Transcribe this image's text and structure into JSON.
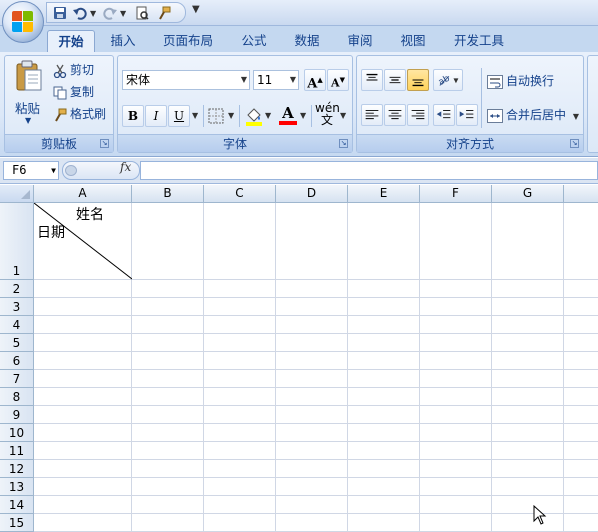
{
  "ribbon": {
    "tabs": [
      {
        "label": "开始",
        "active": true
      },
      {
        "label": "插入"
      },
      {
        "label": "页面布局"
      },
      {
        "label": "公式"
      },
      {
        "label": "数据"
      },
      {
        "label": "审阅"
      },
      {
        "label": "视图"
      },
      {
        "label": "开发工具"
      }
    ],
    "clipboard": {
      "paste": "粘贴",
      "cut": "剪切",
      "copy": "复制",
      "format_painter": "格式刷",
      "group_label": "剪贴板"
    },
    "font": {
      "font_name": "宋体",
      "font_size": "11",
      "grow_font": "A",
      "shrink_font": "A",
      "bold": "B",
      "italic": "I",
      "underline": "U",
      "font_color": "A",
      "phonetic": "wén 文",
      "group_label": "字体"
    },
    "alignment": {
      "wrap_text": "自动换行",
      "merge_center": "合并后居中",
      "group_label": "对齐方式"
    }
  },
  "formula_bar": {
    "name_box": "F6",
    "fx": "fx",
    "formula": ""
  },
  "sheet": {
    "columns": [
      "A",
      "B",
      "C",
      "D",
      "E",
      "F",
      "G"
    ],
    "rows": [
      "1",
      "2",
      "3",
      "4",
      "5",
      "6",
      "7",
      "8",
      "9",
      "10",
      "11",
      "12",
      "13",
      "14",
      "15"
    ],
    "cell_a1_top": "姓名",
    "cell_a1_bottom": "日期"
  },
  "colors": {
    "ribbon_bg": "#dce8f8",
    "tab_text": "#15428b",
    "grid_line": "#d0d7e5",
    "header_border": "#9eb6ce"
  }
}
